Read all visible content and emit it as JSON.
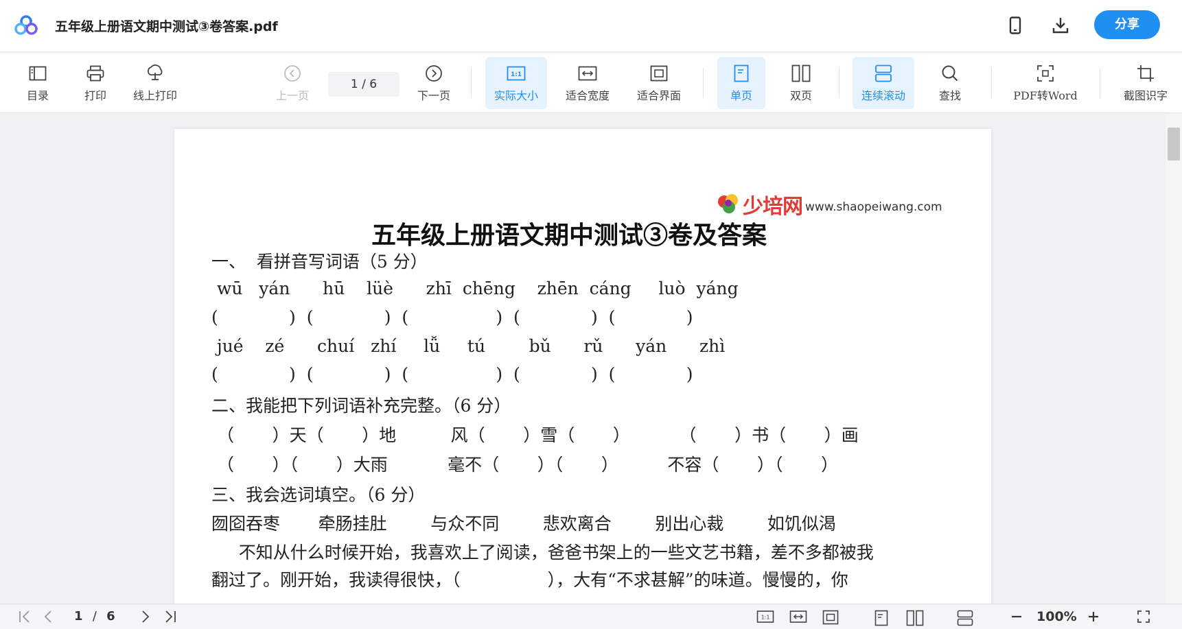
{
  "titlebar": {
    "title": "五年级上册语文期中测试③卷答案.pdf",
    "share_label": "分享",
    "icons": [
      "app-logo-icon",
      "phone-icon",
      "download-icon"
    ]
  },
  "toolbar": {
    "toc": "目录",
    "print": "打印",
    "online_print": "线上打印",
    "prev_page": "上一页",
    "page_indicator": "1  /  6",
    "next_page": "下一页",
    "actual_size": "实际大小",
    "fit_width": "适合宽度",
    "fit_screen": "适合界面",
    "single_page": "单页",
    "double_page": "双页",
    "continuous_scroll": "连续滚动",
    "find": "查找",
    "pdf_to_word": "PDF转Word",
    "screenshot_ocr": "截图识字",
    "actual_size_icon_text": "1:1"
  },
  "document": {
    "watermark_logo": "少培网",
    "watermark_url": "www.shaopeiwang.com",
    "heading": "五年级上册语文期中测试③卷及答案",
    "lines": [
      "一、  看拼音写词语（5 分）",
      " wū   yán      hū    lüè      zhī  chēng    zhēn  cáng     luò  yáng",
      "(             )  (             )  (                )  (             )  (             )",
      " jué    zé      chuí   zhí     lǚ     tú        bǔ      rǔ      yán      zhì",
      "(             )  (             )  (                )  (             )  (             )",
      "二、我能把下列词语补充完整。（6 分）",
      " （       ）天（       ）地          风（       ）雪（       ）         （       ）书（       ）画",
      " （       ）（       ）大雨           毫不（       ）（       ）         不容（       ）（       ）",
      "三、我会选词填空。（6 分）",
      "囫囵吞枣       牵肠挂肚        与众不同        悲欢离合        别出心裁        如饥似渴",
      "     不知从什么时候开始，我喜欢上了阅读，爸爸书架上的一些文艺书籍，差不多都被我",
      "翻过了。刚开始，我读得很快，（                ），大有“不求甚解”的味道。慢慢的，你"
    ]
  },
  "bottombar": {
    "current_page": "1",
    "slash": "/",
    "total_pages": "6",
    "zoom": "100%",
    "actual_size_text": "1:1"
  },
  "colors": {
    "accent": "#1f8ff1",
    "active_bg": "#e6f2fd"
  }
}
